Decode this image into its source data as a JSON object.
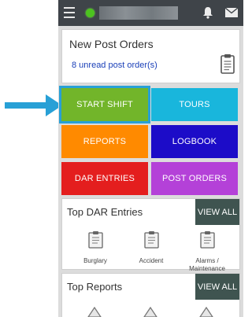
{
  "post_orders": {
    "title": "New Post Orders",
    "unread_link": "8 unread post order(s)",
    "icon": "clipboard-icon"
  },
  "tiles": {
    "start_shift": "START SHIFT",
    "tours": "TOURS",
    "reports": "REPORTS",
    "logbook": "LOGBOOK",
    "dar_entries": "DAR ENTRIES",
    "post_orders": "POST ORDERS"
  },
  "top_dar": {
    "title": "Top DAR Entries",
    "view_all": "VIEW ALL",
    "entries": [
      {
        "label": "Burglary",
        "icon": "clipboard-icon"
      },
      {
        "label": "Accident",
        "icon": "clipboard-icon"
      },
      {
        "label": "Alarms / Maintenance",
        "icon": "clipboard-icon"
      }
    ]
  },
  "top_reports": {
    "title": "Top Reports",
    "view_all": "VIEW ALL"
  },
  "colors": {
    "start_shift": "#72b52a",
    "tours": "#19b6dc",
    "reports": "#ff8a00",
    "logbook": "#1c0cc8",
    "dar_entries": "#e41e1e",
    "post_orders": "#b441d8",
    "highlight_arrow": "#28a0d6",
    "view_all_bg": "#3f5450",
    "status_bar": "#3f4449"
  }
}
